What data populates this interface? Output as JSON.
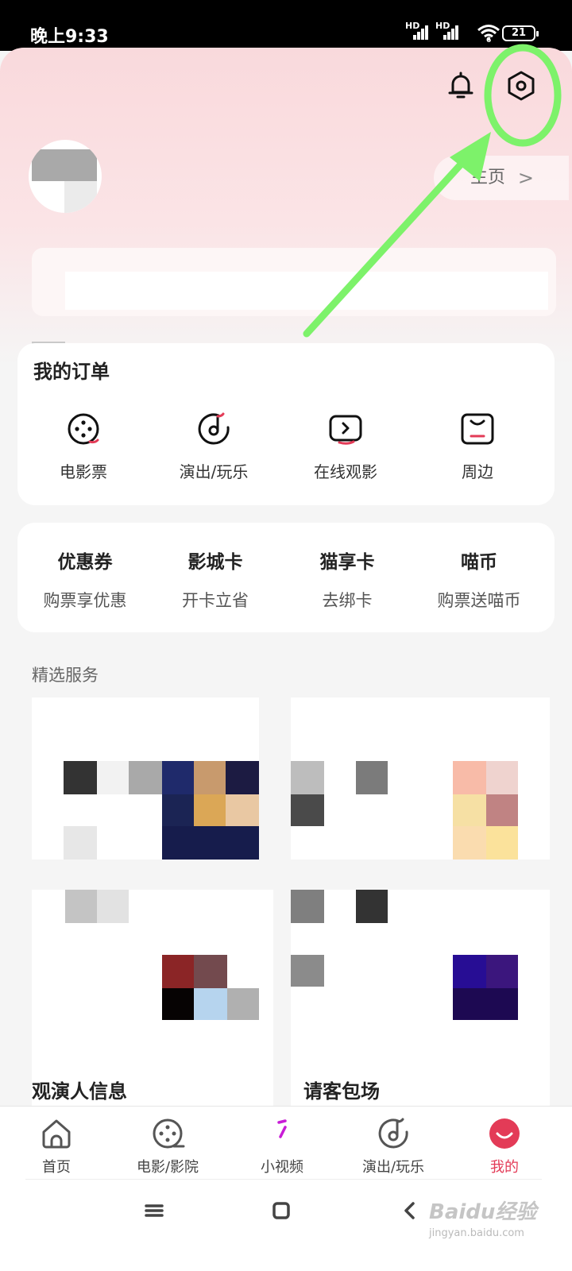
{
  "status_bar": {
    "time": "晚上9:33",
    "sim1_tag": "HD",
    "sim2_tag": "HD",
    "wifi_tag": "6",
    "battery": "21"
  },
  "header": {
    "notification_icon": "bell-icon",
    "settings_icon": "hexagon-settings-icon",
    "homepage_link": "主页",
    "homepage_chevron": ">"
  },
  "orders": {
    "title": "我的订单",
    "items": [
      {
        "label": "电影票",
        "icon": "movie-reel-icon"
      },
      {
        "label": "演出/玩乐",
        "icon": "music-disc-icon"
      },
      {
        "label": "在线观影",
        "icon": "play-tv-icon"
      },
      {
        "label": "周边",
        "icon": "shopping-box-icon"
      }
    ]
  },
  "wallet": {
    "items": [
      {
        "title": "优惠券",
        "subtitle": "购票享优惠"
      },
      {
        "title": "影城卡",
        "subtitle": "开卡立省"
      },
      {
        "title": "猫享卡",
        "subtitle": "去绑卡"
      },
      {
        "title": "喵币",
        "subtitle": "购票送喵币"
      }
    ]
  },
  "services": {
    "title": "精选服务",
    "cards": [
      {
        "label": ""
      },
      {
        "label": ""
      },
      {
        "label": "观演人信息"
      },
      {
        "label": "请客包场"
      }
    ]
  },
  "tab_bar": {
    "items": [
      {
        "label": "首页",
        "icon": "home-icon"
      },
      {
        "label": "电影/影院",
        "icon": "film-reel-icon"
      },
      {
        "label": "小视频",
        "icon": "short-video-icon"
      },
      {
        "label": "演出/玩乐",
        "icon": "music-disc-icon"
      },
      {
        "label": "我的",
        "icon": "profile-smile-icon",
        "active": true
      }
    ],
    "active_color": "#e33b57"
  },
  "system_nav": {
    "buttons": [
      "menu-icon",
      "home-square-icon",
      "back-icon"
    ]
  },
  "watermark": {
    "brand": "Baidu经验",
    "url": "jingyan.baidu.com"
  },
  "colors": {
    "accent": "#e33b57",
    "annotation": "#7df26a",
    "header_gradient": "#f9d9dc"
  }
}
